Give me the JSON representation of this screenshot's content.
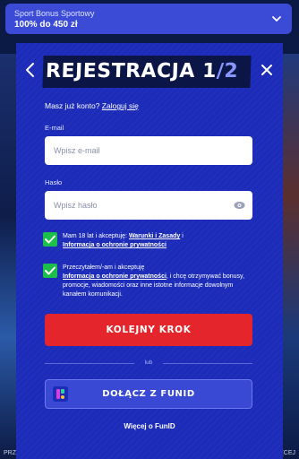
{
  "banner": {
    "subtitle": "Sport Bonus Sportowy",
    "amount": "100% do 450 zł"
  },
  "modal": {
    "title_main": "REJESTRACJA ",
    "title_step": "1",
    "title_sep": "/",
    "title_total": "2",
    "login_prompt": "Masz już konto?",
    "login_link": "Zaloguj się",
    "email": {
      "label": "E-mail",
      "placeholder": "Wpisz e-mail",
      "value": ""
    },
    "password": {
      "label": "Hasło",
      "placeholder": "Wpisz hasło",
      "value": ""
    },
    "consent1": {
      "checked": true,
      "text_a": "Mam 18 lat i akceptuję: ",
      "link_terms": "Warunki i Zasady",
      "text_b": " i",
      "link_privacy": "Informacja o ochronie prywatności"
    },
    "consent2": {
      "checked": true,
      "text_a": "Przeczytałem/-am i akceptuję",
      "link_privacy": "Informacja o ochronie prywatności",
      "text_b": ", i chcę otrzymywać bonusy, promocje, wiadomości oraz inne istotne informacje dowolnym kanałem komunikacji."
    },
    "next_button": "KOLEJNY KROK",
    "or_label": "lub",
    "funid_button": "DOŁĄCZ Z FUNID",
    "more_link": "Więcej o FunID"
  },
  "background": {
    "bottom_left": "PRZECZYTAJ WIĘCEJ",
    "bottom_right": "PRZECZYTAJ WIĘCEJ"
  },
  "colors": {
    "modal_bg": "#1c2bb8",
    "banner_bg": "#3b4bd6",
    "primary_button": "#e4252b",
    "checkbox": "#1bbf4a"
  }
}
